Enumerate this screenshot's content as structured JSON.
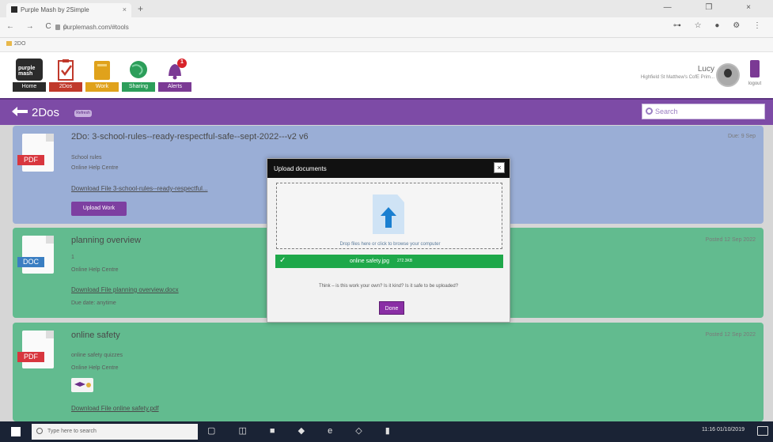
{
  "browser": {
    "tab_title": "Purple Mash by 2Simple",
    "tab_close": "×",
    "new_tab": "+",
    "window_controls": "— ❐ ×",
    "nav_buttons": "← → C ⌂",
    "url": "purplemash.com/#tools",
    "right_icons": "⊶ ☆ ● ⚙ ⋮",
    "bookmark": "2DO"
  },
  "app": {
    "logo_text": "purple mash",
    "nav": [
      {
        "label": "Home",
        "color": "#2b2b2b"
      },
      {
        "label": "2Dos",
        "color": "#c0392b"
      },
      {
        "label": "Work",
        "color": "#e0a21b"
      },
      {
        "label": "Sharing",
        "color": "#2c9e5a"
      },
      {
        "label": "Alerts",
        "color": "#7b3a94"
      }
    ],
    "alert_count": "1",
    "user_name": "Lucy",
    "user_school": "Highfield St Matthew's CofE Prim...",
    "logout_label": "logout"
  },
  "strip": {
    "title": "2Dos",
    "refresh_label": "Refresh",
    "search_placeholder": "Search"
  },
  "cards": [
    {
      "title": "2Do: 3-school-rules--ready-respectful-safe--sept-2022---v2 v6",
      "date": "Due: 9 Sep",
      "ext": "PDF",
      "ext_color": "#d8363e",
      "meta1": "School rules",
      "meta2": "Online Help Centre",
      "download": "Download File 3-school-rules--ready-respectful...",
      "button": "Upload Work",
      "bg": "#9aaed6"
    },
    {
      "title": "planning overview",
      "date": "Posted 12 Sep 2022",
      "ext": "DOC",
      "ext_color": "#3a7ec2",
      "meta1": "1",
      "meta2": "Online Help Centre",
      "download": "Download File planning overview.docx",
      "meta3": "Due date: anytime",
      "bg": "#62bb8f"
    },
    {
      "title": "online safety",
      "date": "Posted 12 Sep 2022",
      "ext": "PDF",
      "ext_color": "#d8363e",
      "meta1": "online safety quizzes",
      "meta2": "Online Help Centre",
      "download": "Download File online safety.pdf",
      "bg": "#62bb8f"
    }
  ],
  "modal": {
    "title": "Upload documents",
    "close": "×",
    "drop_text": "Drop files here or click to browse your computer",
    "file_name": "online safety.jpg",
    "file_size": "272.3KB",
    "note": "Think – is this work your own? Is it kind? Is it safe to be uploaded?",
    "done": "Done"
  },
  "taskbar": {
    "search_placeholder": "Type here to search",
    "apps": "▢ ◫ ■ ◆ e ◇ ▮",
    "time": "11:16",
    "date": "01/10/2019"
  }
}
